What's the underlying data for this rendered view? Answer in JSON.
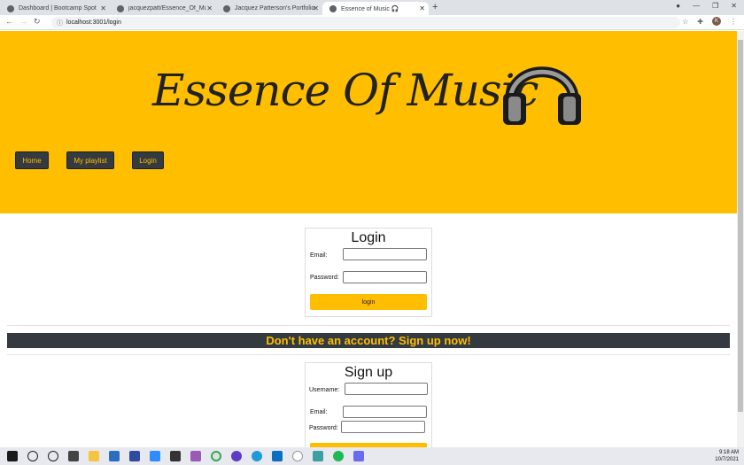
{
  "browser": {
    "tabs": [
      {
        "title": "Dashboard | Bootcamp Spot",
        "active": false
      },
      {
        "title": "jacquezpatt/Essence_Of_Music: E",
        "active": false
      },
      {
        "title": "Jacquez Patterson's Portfolio",
        "active": false
      },
      {
        "title": "Essence of Music 🎧",
        "active": true
      }
    ],
    "new_tab": "+",
    "url": "localhost:3001/login",
    "profile_initial": "K"
  },
  "hero": {
    "title": "Essence Of Music",
    "bg_color": "#ffbf00",
    "nav": [
      {
        "label": "Home"
      },
      {
        "label": "My playlist"
      },
      {
        "label": "Login"
      }
    ]
  },
  "login": {
    "heading": "Login",
    "email_label": "Email:",
    "password_label": "Password:",
    "email_value": "",
    "password_value": "",
    "submit_label": "login"
  },
  "banner": {
    "text": "Don't have an account? Sign up now!"
  },
  "signup": {
    "heading": "Sign up",
    "username_label": "Username:",
    "email_label": "Email:",
    "password_label": "Password:"
  },
  "taskbar": {
    "time": "9:18 AM",
    "date": "10/7/2021"
  },
  "colors": {
    "accent": "#ffbf00",
    "dark": "#343a40"
  }
}
